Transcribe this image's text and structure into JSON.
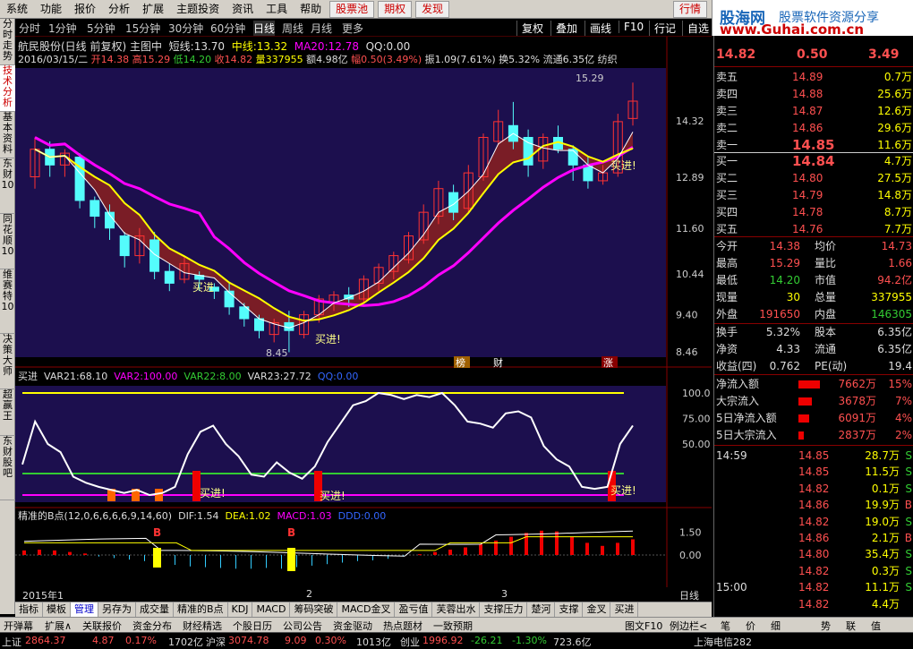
{
  "menu": [
    "系统",
    "功能",
    "报价",
    "分析",
    "扩展",
    "主题投资",
    "资讯",
    "工具",
    "帮助"
  ],
  "menu_special": [
    "股票池",
    "期权",
    "发现"
  ],
  "menu_right": [
    "行情",
    "交易",
    "服务"
  ],
  "logo": {
    "line1": "股海网",
    "line2": "股票软件资源分享",
    "line3": "www.Guhai.com.cn"
  },
  "left_tabs": [
    "分时走势",
    "技术分析",
    "基本资料",
    "东财10",
    "同花顺10",
    "维赛特10",
    "决策大师",
    "超赢王",
    "东财股吧"
  ],
  "periods": [
    "分时",
    "1分钟",
    "5分钟",
    "15分钟",
    "30分钟",
    "60分钟",
    "日线",
    "周线",
    "月线",
    "更多"
  ],
  "active_period": "日线",
  "chart_buttons": [
    "复权",
    "叠加",
    "画线",
    "F10",
    "行记"
  ],
  "self_select": "自选",
  "stock": {
    "name": "航民股份(日线 前复权) 主图中",
    "short_label": "短线:",
    "short": "13.70",
    "mid_label": "中线:",
    "mid": "13.32",
    "ma20_label": "MA20:",
    "ma20": "12.78",
    "qq_label": "QQ:",
    "qq": "0.00"
  },
  "ohlc": {
    "date": "2016/03/15/二",
    "open_label": "开",
    "open": "14.38",
    "high_label": "高",
    "high": "15.29",
    "low_label": "低",
    "low": "14.20",
    "close_label": "收",
    "close": "14.82",
    "vol_label": "量",
    "vol": "337955",
    "amt_label": "额",
    "amt": "4.98亿",
    "chg_label": "幅",
    "chg": "0.50(3.49%)",
    "amp_label": "振",
    "amp": "1.09(7.61%)",
    "turn_label": "换",
    "turn": "5.32%",
    "float_label": "流通",
    "float": "6.35亿",
    "ind": "纺织"
  },
  "main_axis": [
    "14.32",
    "12.89",
    "11.60",
    "10.44",
    "9.40",
    "8.46"
  ],
  "main_labels": {
    "high": "15.29",
    "low": "8.45",
    "buy": "买进",
    "buy2": "买进!",
    "tags": [
      "榜",
      "财",
      "涨"
    ]
  },
  "ind1": {
    "name": "买进",
    "var21_label": "VAR21:",
    "var21": "68.10",
    "var2_label": "VAR2:",
    "var2": "100.00",
    "var22_label": "VAR22:",
    "var22": "8.00",
    "var23_label": "VAR23:",
    "var23": "27.72",
    "qq_label": "QQ:",
    "qq": "0.00"
  },
  "ind1_axis": [
    "100.0",
    "75.00",
    "50.00"
  ],
  "ind1_labels": {
    "buy": "买进!",
    "small": [
      "买",
      "买",
      "买"
    ]
  },
  "ind2": {
    "name": "精准的B点(12,0,6,6,6,6,9,14,60)",
    "dif_label": "DIF:",
    "dif": "1.54",
    "dea_label": "DEA:",
    "dea": "1.02",
    "macd_label": "MACD:",
    "macd": "1.03",
    "ddd_label": "DDD:",
    "ddd": "0.00"
  },
  "ind2_axis": [
    "1.50",
    "0.00"
  ],
  "ind2_labels": {
    "b": "B"
  },
  "time_axis": {
    "start": "2015年1",
    "m2": "2",
    "m3": "3",
    "period": "日线"
  },
  "bottom_tabs": [
    "指标",
    "模板",
    "管理",
    "另存为",
    "成交量",
    "精准的B点",
    "KDJ",
    "MACD",
    "筹码突破",
    "MACD金叉",
    "盈亏值",
    "芙蓉出水",
    "支撑压力",
    "楚河",
    "支撑",
    "金叉",
    "买进"
  ],
  "bottom_tab_active": "管理",
  "bottom_tabs2": [
    "开弹幕",
    "扩展∧",
    "关联报价",
    "资金分布",
    "财经精选",
    "个股日历",
    "公司公告",
    "资金驱动",
    "热点题材",
    "一致预期"
  ],
  "bottom_tabs2_right": [
    "图文F10",
    "例边栏<",
    "笔",
    "价",
    "细",
    "势",
    "联",
    "值"
  ],
  "status": {
    "sh_label": "上证",
    "sh": "2864.37",
    "sh_chg": "4.87",
    "sh_pct": "0.17%",
    "sh_amt": "1702亿",
    "sz_label": "沪深",
    "sz": "3074.78",
    "sz_chg": "9.09",
    "sz_pct": "0.30%",
    "sz_amt": "1013亿",
    "cy_label": "创业",
    "cy": "1996.92",
    "cy_chg": "-26.21",
    "cy_pct": "-1.30%",
    "cy_amt": "723.6亿",
    "server": "上海电信282"
  },
  "quote_header": {
    "price": "14.82",
    "chg": "0.50",
    "pct": "3.49"
  },
  "asks": [
    {
      "label": "卖五",
      "price": "14.89",
      "vol": "0.7万"
    },
    {
      "label": "卖四",
      "price": "14.88",
      "vol": "25.6万"
    },
    {
      "label": "卖三",
      "price": "14.87",
      "vol": "12.6万"
    },
    {
      "label": "卖二",
      "price": "14.86",
      "vol": "29.6万"
    },
    {
      "label": "卖一",
      "price": "14.85",
      "vol": "11.6万"
    }
  ],
  "bids": [
    {
      "label": "买一",
      "price": "14.84",
      "vol": "4.7万"
    },
    {
      "label": "买二",
      "price": "14.80",
      "vol": "27.5万"
    },
    {
      "label": "买三",
      "price": "14.79",
      "vol": "14.8万"
    },
    {
      "label": "买四",
      "price": "14.78",
      "vol": "8.7万"
    },
    {
      "label": "买五",
      "price": "14.76",
      "vol": "7.7万"
    }
  ],
  "stats": [
    {
      "l1": "今开",
      "v1": "14.38",
      "l2": "均价",
      "v2": "14.73"
    },
    {
      "l1": "最高",
      "v1": "15.29",
      "l2": "量比",
      "v2": "1.66"
    },
    {
      "l1": "最低",
      "v1": "14.20",
      "l2": "市值",
      "v2": "94.2亿"
    },
    {
      "l1": "现量",
      "v1": "30",
      "l2": "总量",
      "v2": "337955"
    },
    {
      "l1": "外盘",
      "v1": "191650",
      "l2": "内盘",
      "v2": "146305"
    }
  ],
  "stats2": [
    {
      "l1": "换手",
      "v1": "5.32%",
      "l2": "股本",
      "v2": "6.35亿"
    },
    {
      "l1": "净资",
      "v1": "4.33",
      "l2": "流通",
      "v2": "6.35亿"
    },
    {
      "l1": "收益(四)",
      "v1": "0.762",
      "l2": "PE(动)",
      "v2": "19.4"
    }
  ],
  "flows": [
    {
      "label": "净流入额",
      "value": "7662万",
      "pct": "15%",
      "bar": 0.4
    },
    {
      "label": "大宗流入",
      "value": "3678万",
      "pct": "7%",
      "bar": 0.25
    },
    {
      "label": "5日净流入额",
      "value": "6091万",
      "pct": "4%",
      "bar": 0.2
    },
    {
      "label": "5日大宗流入",
      "value": "2837万",
      "pct": "2%",
      "bar": 0.1
    }
  ],
  "ticks": [
    {
      "time": "14:59",
      "price": "14.85",
      "vol": "28.7万",
      "side": "S"
    },
    {
      "time": "",
      "price": "14.85",
      "vol": "11.5万",
      "side": "S"
    },
    {
      "time": "",
      "price": "14.82",
      "vol": "0.1万",
      "side": "S"
    },
    {
      "time": "",
      "price": "14.86",
      "vol": "19.9万",
      "side": "B"
    },
    {
      "time": "",
      "price": "14.82",
      "vol": "19.0万",
      "side": "S"
    },
    {
      "time": "",
      "price": "14.86",
      "vol": "2.1万",
      "side": "B"
    },
    {
      "time": "",
      "price": "14.80",
      "vol": "35.4万",
      "side": "S"
    },
    {
      "time": "",
      "price": "14.82",
      "vol": "0.3万",
      "side": "S"
    },
    {
      "time": "15:00",
      "price": "14.82",
      "vol": "11.1万",
      "side": "S"
    },
    {
      "time": "",
      "price": "14.82",
      "vol": "4.4万",
      "side": ""
    }
  ],
  "colors": {
    "up": "#ff3232",
    "down": "#54fcfc",
    "ma_short": "#ffffff",
    "ma_mid": "#ffff00",
    "ma20": "#ff00ff",
    "fill": "#8b2020"
  }
}
